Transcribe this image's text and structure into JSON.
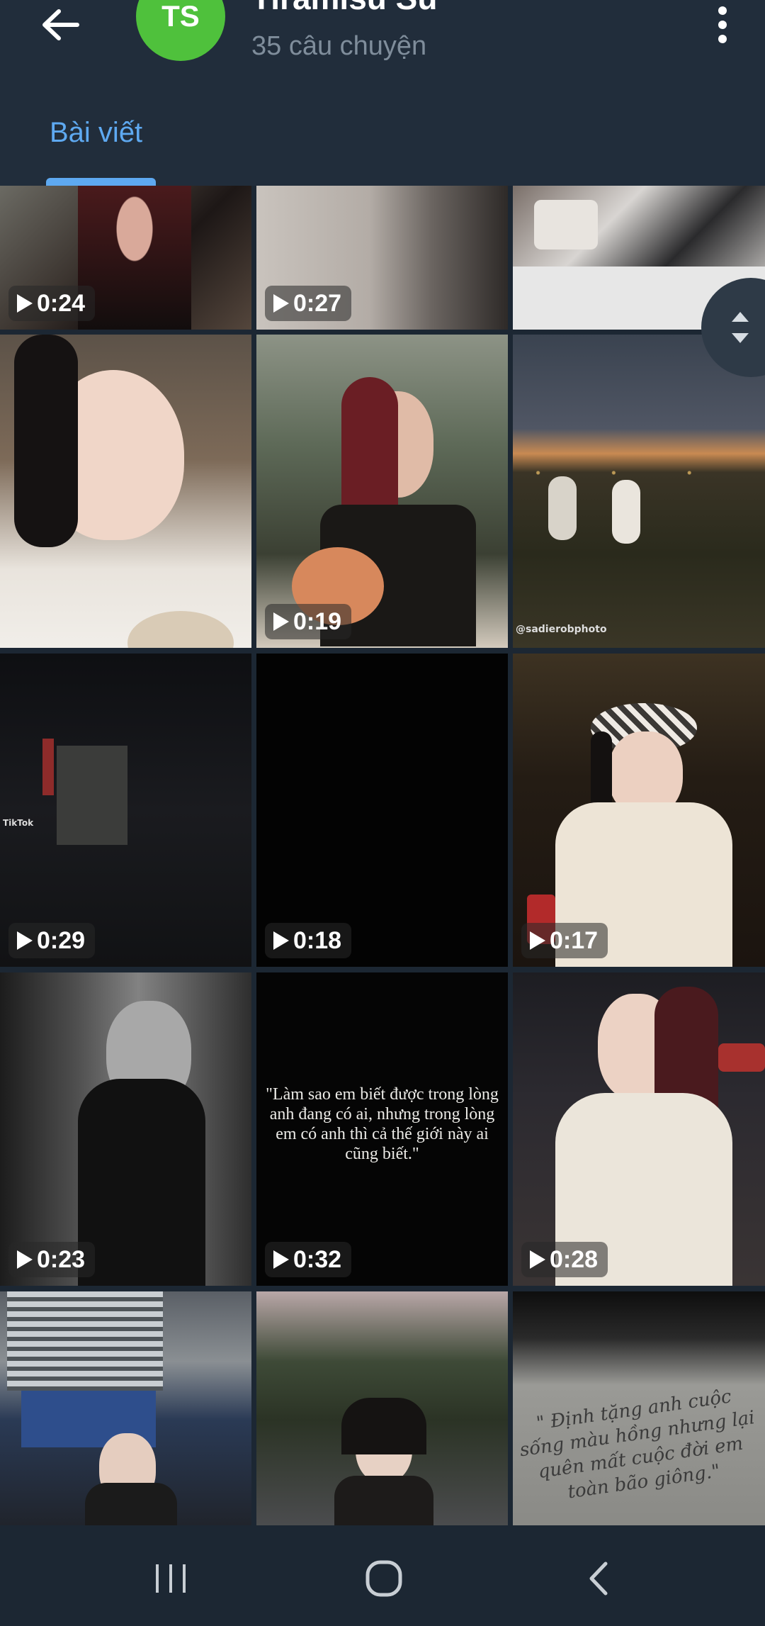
{
  "header": {
    "avatar_initials": "TS",
    "title": "Tiramisu Su",
    "subtitle": "35 câu chuyện",
    "tab_label": "Bài viết"
  },
  "tiles": [
    {
      "duration": "0:24"
    },
    {
      "duration": "0:27"
    },
    {
      "duration": ""
    },
    {
      "duration": ""
    },
    {
      "duration": "0:19"
    },
    {
      "duration": ""
    },
    {
      "duration": "0:29"
    },
    {
      "duration": "0:18"
    },
    {
      "duration": "0:17"
    },
    {
      "duration": "0:23"
    },
    {
      "duration": "0:32"
    },
    {
      "duration": "0:28"
    },
    {
      "duration": ""
    },
    {
      "duration": ""
    },
    {
      "duration": ""
    }
  ],
  "captions": {
    "quote": "\"Làm sao em biết được trong lòng anh đang có ai, nhưng trong lòng em có anh thì cả thế giới này ai cũng biết.\"",
    "handwriting": "\" Định tặng anh cuộc sống màu hồng nhưng lại quên mất cuộc đời em toàn bão giông.\"",
    "watermark_sadie": "@sadierobphoto",
    "watermark_tiktok": "TikTok"
  },
  "colors": {
    "header_bg": "#212d3b",
    "page_bg": "#1c2733",
    "accent": "#5ea9f1",
    "avatar": "#4fc13c"
  }
}
